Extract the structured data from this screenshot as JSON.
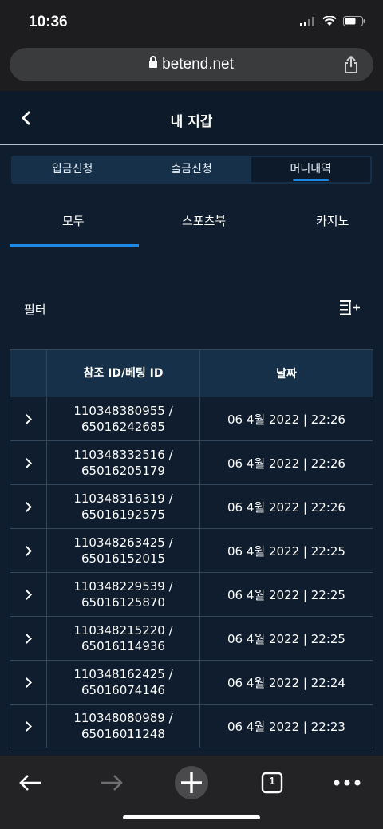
{
  "status": {
    "time": "10:36"
  },
  "browser": {
    "url": "betend.net",
    "tab_count": "1"
  },
  "header": {
    "title": "내 지갑"
  },
  "segments": [
    {
      "label": "입금신청",
      "active": false
    },
    {
      "label": "출금신청",
      "active": false
    },
    {
      "label": "머니내역",
      "active": true
    }
  ],
  "tabs": [
    {
      "label": "모두",
      "active": true
    },
    {
      "label": "스포츠북",
      "active": false
    },
    {
      "label": "카지노",
      "active": false
    }
  ],
  "filter": {
    "label": "필터"
  },
  "table": {
    "columns": [
      "",
      "참조 ID/베팅 ID",
      "날짜"
    ],
    "rows": [
      {
        "ref": "110348380955 /",
        "bet": "65016242685",
        "date": "06 4월 2022 | 22:26"
      },
      {
        "ref": "110348332516 /",
        "bet": "65016205179",
        "date": "06 4월 2022 | 22:26"
      },
      {
        "ref": "110348316319 /",
        "bet": "65016192575",
        "date": "06 4월 2022 | 22:26"
      },
      {
        "ref": "110348263425 /",
        "bet": "65016152015",
        "date": "06 4월 2022 | 22:25"
      },
      {
        "ref": "110348229539 /",
        "bet": "65016125870",
        "date": "06 4월 2022 | 22:25"
      },
      {
        "ref": "110348215220 /",
        "bet": "65016114936",
        "date": "06 4월 2022 | 22:25"
      },
      {
        "ref": "110348162425 /",
        "bet": "65016074146",
        "date": "06 4월 2022 | 22:24"
      },
      {
        "ref": "110348080989 /",
        "bet": "65016011248",
        "date": "06 4월 2022 | 22:23"
      }
    ]
  },
  "colors": {
    "accent": "#1e88e5",
    "background": "#0f1d2e",
    "header_bg": "#163049"
  },
  "icons": [
    "wifi-icon",
    "battery-icon",
    "signal-icon",
    "lock-icon",
    "share-icon",
    "back-icon",
    "filter-icon",
    "chevron-right-icon",
    "arrow-left-icon",
    "arrow-right-icon",
    "plus-icon",
    "tabs-icon",
    "more-icon"
  ]
}
